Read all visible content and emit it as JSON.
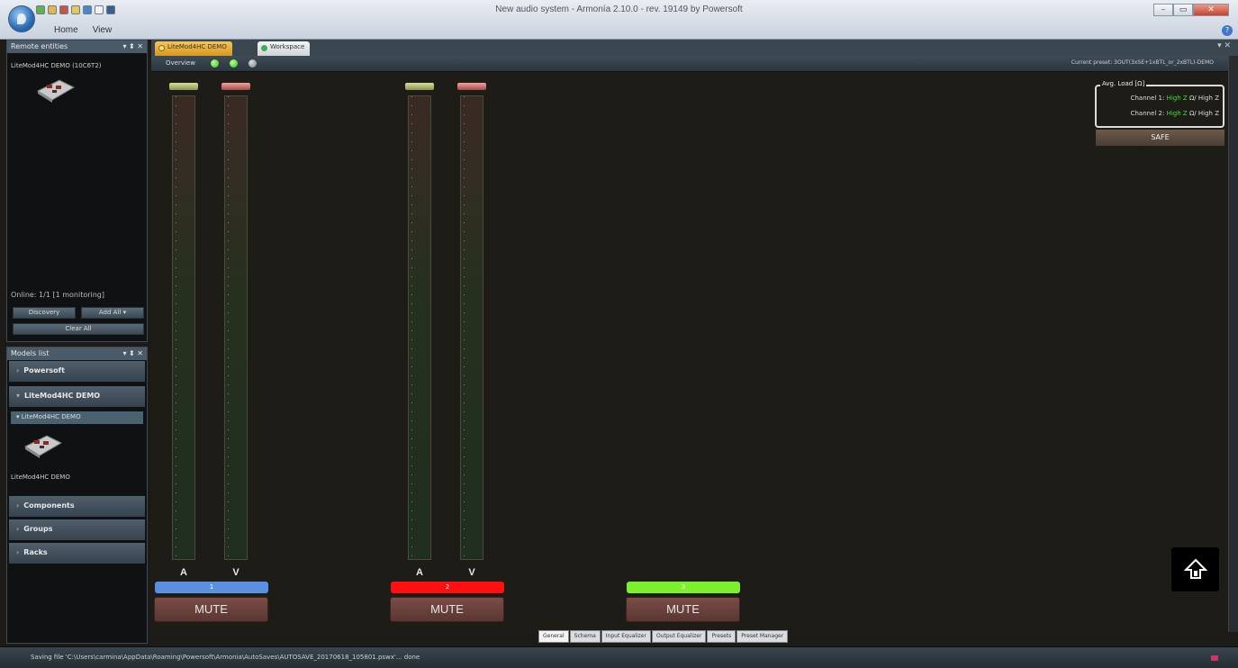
{
  "window": {
    "title": "New audio system - Armonía 2.10.0 - rev. 19149 by Powersoft",
    "menu": [
      "Home",
      "View"
    ],
    "controls": [
      "–",
      "▭",
      "✕"
    ]
  },
  "remote_panel": {
    "title": "Remote entities",
    "pin": "▾ ⬍ ✕",
    "device_label": "LiteMod4HC DEMO (10C6T2)",
    "online_status": "Online: 1/1 [1 monitoring]",
    "discovery_label": "Discovery",
    "add_all_label": "Add All",
    "clear_all_label": "Clear All"
  },
  "models_panel": {
    "title": "Models list",
    "pin": "▾ ⬍ ✕",
    "groups": [
      "Powersoft",
      "LiteMod4HC DEMO",
      "Components",
      "Groups",
      "Racks"
    ],
    "subgroup": "LiteMod4HC DEMO",
    "device_label": "LiteMod4HC DEMO"
  },
  "tabs": {
    "device_tab": "LiteMod4HC DEMO",
    "workspace_tab": "Workspace",
    "close": "▾ ✕"
  },
  "overview": {
    "label": "Overview",
    "current_preset": "Current preset: 3OUT(3xSE+1xBTL_or_2xBTL)-DEMO"
  },
  "meters": {
    "letter_a": "A",
    "letter_v": "V"
  },
  "channels": [
    {
      "number": "1",
      "color": "#5b8fe0",
      "mute_label": "MUTE"
    },
    {
      "number": "2",
      "color": "#ff1010",
      "mute_label": "MUTE"
    },
    {
      "number": "3",
      "color": "#7df02c",
      "mute_label": "MUTE"
    }
  ],
  "avg_load": {
    "title": "Avg. Load [Ω]",
    "rows": [
      {
        "label": "Channel 1:",
        "value": "High Z",
        "sep": "Ω/",
        "nominal": "High Z"
      },
      {
        "label": "Channel 2:",
        "value": "High Z",
        "sep": "Ω/",
        "nominal": "High Z"
      }
    ],
    "safe_label": "SAFE"
  },
  "bottom_tabs": [
    "General",
    "Schema",
    "Input Equalizer",
    "Output Equalizer",
    "Presets",
    "Preset Manager"
  ],
  "status": {
    "text": "Saving file 'C:\\Users\\carmina\\AppData\\Roaming\\Powersoft\\Armonia\\AutoSaves\\AUTOSAVE_20170618_105801.pswx'... done"
  },
  "colors": {
    "accent": "#d8991d",
    "led_on": "#34c11a",
    "load_value": "#42e02f"
  }
}
